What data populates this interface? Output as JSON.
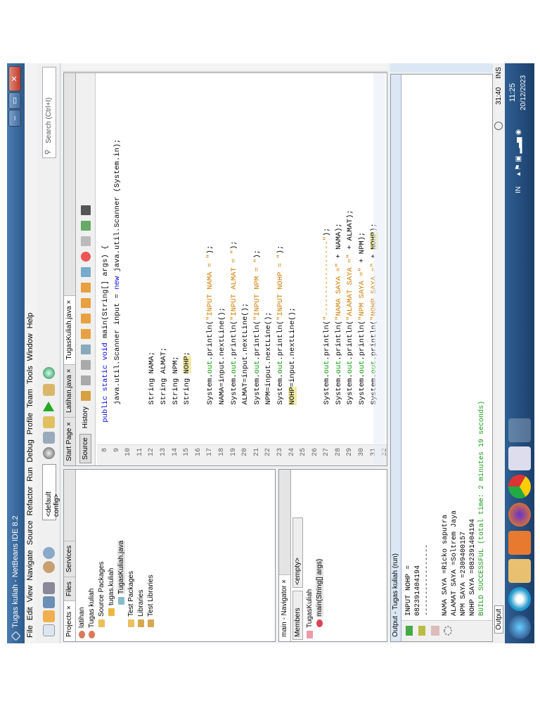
{
  "window": {
    "title": "Tugas kuliah - NetBeans IDE 8.2",
    "min": "–",
    "max": "▭",
    "close": "✕"
  },
  "menu": [
    "File",
    "Edit",
    "View",
    "Navigate",
    "Source",
    "Refactor",
    "Run",
    "Debug",
    "Profile",
    "Team",
    "Tools",
    "Window",
    "Help"
  ],
  "toolbar": {
    "config": "<default config>",
    "search_placeholder": "Search (Ctrl+I)"
  },
  "projects": {
    "tabs": [
      "Projects ×",
      "Files",
      "Services"
    ],
    "tree": [
      "latihan",
      "Tugas kuliah",
      "Source Packages",
      "tugas.kuliah",
      "TugasKuliah.java",
      "Test Packages",
      "Libraries",
      "Test Libraries"
    ]
  },
  "navigator": {
    "title": "main - Navigator ×",
    "members": "Members",
    "filter": "<empty>",
    "tree": [
      "TugasKuliah",
      "main(String[] args)"
    ]
  },
  "editor": {
    "tabs": [
      "Start Page ×",
      "Latihan.java ×",
      "TugasKuliah.java ×"
    ],
    "source": "Source",
    "history": "History",
    "lines": [
      {
        "n": "8",
        "t": "    public static void main(String[] args) {"
      },
      {
        "n": "9",
        "t": "        java.util.Scanner input = new java.util.Scanner (System.in);"
      },
      {
        "n": "10",
        "t": ""
      },
      {
        "n": "11",
        "t": ""
      },
      {
        "n": "12",
        "t": "        String NAMA;"
      },
      {
        "n": "13",
        "t": "        String ALMAT;"
      },
      {
        "n": "14",
        "t": "        String NPM;"
      },
      {
        "n": "15",
        "t": "        String NOHP;"
      },
      {
        "n": "16",
        "t": ""
      },
      {
        "n": "17",
        "t": "        System.out.println(\"INPUT NAMA = \");"
      },
      {
        "n": "18",
        "t": "        NAMA=input.nextLine();"
      },
      {
        "n": "19",
        "t": "        System.out.println(\"INPUT ALMAT = \");"
      },
      {
        "n": "20",
        "t": "        ALMAT=input.nextLine();"
      },
      {
        "n": "21",
        "t": "        System.out.println(\"INPUT NPM = \");"
      },
      {
        "n": "22",
        "t": "        NPM=input.nextLine();"
      },
      {
        "n": "23",
        "t": "        System.out.println(\"INPUT NOHP = \");"
      },
      {
        "n": "24",
        "t": "        NOHP=input.nextLine();"
      },
      {
        "n": "25",
        "t": ""
      },
      {
        "n": "26",
        "t": ""
      },
      {
        "n": "27",
        "t": "        System.out.println(\"-----------------\");"
      },
      {
        "n": "28",
        "t": "        System.out.println(\"NAMA SAYA =\" + NAMA);"
      },
      {
        "n": "29",
        "t": "        System.out.println(\"ALAMAT SAYA =\" + ALMAT);"
      },
      {
        "n": "30",
        "t": "        System.out.println(\"NPM SAYA =\" + NPM);"
      },
      {
        "n": "31",
        "t": "        System.out.println(\"NOHP SAYA =\" + NOHP);"
      },
      {
        "n": "32",
        "t": ""
      }
    ]
  },
  "output": {
    "title": "Output - Tugas kuliah (run)",
    "lines": [
      "INPUT NOHP =",
      "082391404194",
      "-----------------",
      "",
      "NAMA SAYA =Ricko saputra",
      "ALAMAT SAYA =Soltrem Jaya",
      "NPM SAYA =2309400157",
      "NOHP SAYA =082391404194"
    ],
    "build": "BUILD SUCCESSFUL (total time: 2 minutes 19 seconds)"
  },
  "status": {
    "output_button": "Output",
    "position": "31:40",
    "mode": "INS"
  },
  "taskbar": {
    "lang": "IN",
    "time": "11:25",
    "date": "20/12/2023"
  }
}
